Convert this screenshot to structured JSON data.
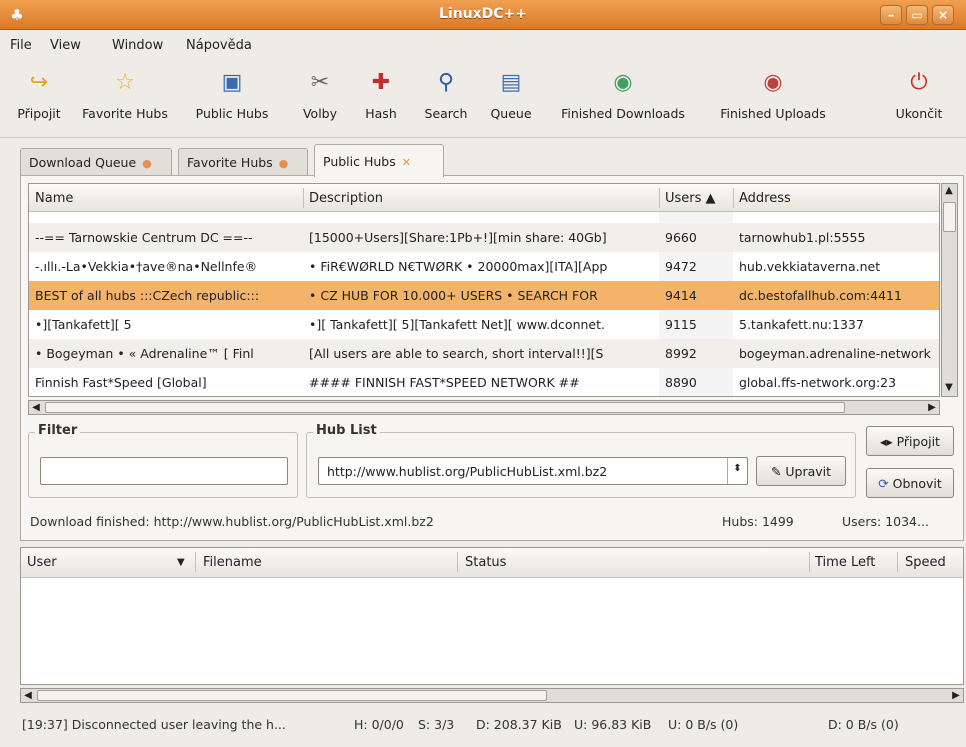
{
  "window": {
    "title": "LinuxDC++",
    "minimize": "–",
    "maximize": "▭",
    "close": "×"
  },
  "menu": {
    "file": "File",
    "view": "View",
    "window": "Window",
    "help": "Nápověda"
  },
  "toolbar": [
    {
      "label": "Připojit",
      "icon": "↪",
      "color": "#e8a020"
    },
    {
      "label": "Favorite Hubs",
      "icon": "☆",
      "color": "#e8b020"
    },
    {
      "label": "Public Hubs",
      "icon": "▣",
      "color": "#3a6ab0"
    },
    {
      "label": "Volby",
      "icon": "✂",
      "color": "#666666"
    },
    {
      "label": "Hash",
      "icon": "✚",
      "color": "#c03030"
    },
    {
      "label": "Search",
      "icon": "⚲",
      "color": "#3060a8"
    },
    {
      "label": "Queue",
      "icon": "▤",
      "color": "#4070b0"
    },
    {
      "label": "Finished Downloads",
      "icon": "◉",
      "color": "#40a060"
    },
    {
      "label": "Finished Uploads",
      "icon": "◉",
      "color": "#c04040"
    },
    {
      "label": "Ukončit",
      "icon": "⏻",
      "color": "#d03020"
    }
  ],
  "tabs": [
    {
      "label": "Download Queue"
    },
    {
      "label": "Favorite Hubs"
    },
    {
      "label": "Public Hubs"
    }
  ],
  "hubs": {
    "columns": {
      "name": "Name",
      "description": "Description",
      "users": "Users ▲",
      "address": "Address"
    },
    "rows": [
      {
        "name": "--== Tarnowskie Centrum DC ==--",
        "description": "[15000+Users][Share:1Pb+!][min share: 40Gb]",
        "users": "9660",
        "address": "tarnowhub1.pl:5555"
      },
      {
        "name": "-.ıllı.-La•Vekkia•†ave®na•Nellnfe®",
        "description": "• FiR€WØRLD N€TWØRK • 20000max][ITA][App",
        "users": "9472",
        "address": "hub.vekkiataverna.net"
      },
      {
        "name": "BEST of all hubs :::CZech republic:::",
        "description": "• CZ HUB FOR 10.000+ USERS • SEARCH FOR",
        "users": "9414",
        "address": "dc.bestofallhub.com:4411"
      },
      {
        "name": "•][Tankafett][ 5",
        "description": "•][ Tankafett][ 5][Tankafett Net][ www.dconnet.",
        "users": "9115",
        "address": "5.tankafett.nu:1337"
      },
      {
        "name": "• Bogeyman •  « Adrenaline™ [ Finl",
        "description": "[All users are able to search, short interval!!][S",
        "users": "8992",
        "address": "bogeyman.adrenaline-network"
      },
      {
        "name": "Finnish Fast*Speed [Global]",
        "description": "#### FINNISH FAST*SPEED NETWORK ##",
        "users": "8890",
        "address": "global.ffs-network.org:23"
      }
    ]
  },
  "filter": {
    "legend": "Filter",
    "value": ""
  },
  "hublist": {
    "legend": "Hub List",
    "value": "http://www.hublist.org/PublicHubList.xml.bz2",
    "edit_label": "Upravit"
  },
  "buttons": {
    "connect": "Připojit",
    "refresh": "Obnovit"
  },
  "status": {
    "message": "Download finished: http://www.hublist.org/PublicHubList.xml.bz2",
    "hubs": "Hubs: 1499",
    "users": "Users: 1034..."
  },
  "transfers": {
    "columns": {
      "user": "User",
      "filename": "Filename",
      "status": "Status",
      "time_left": "Time Left",
      "speed": "Speed"
    }
  },
  "statusbar": {
    "log": "[19:37] Disconnected user leaving the h...",
    "hubs": "H: 0/0/0",
    "slots": "S: 3/3",
    "downloaded": "D: 208.37 KiB",
    "uploaded": "U: 96.83 KiB",
    "up_rate": "U: 0 B/s (0)",
    "down_rate": "D: 0 B/s (0)"
  }
}
